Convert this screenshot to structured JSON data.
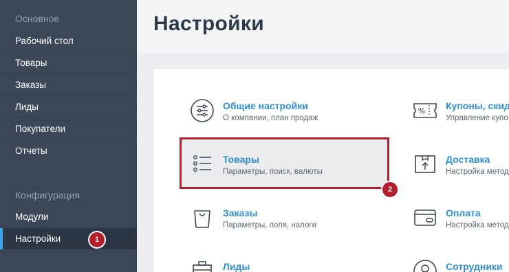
{
  "sidebar": {
    "section_main": "Основное",
    "main_items": [
      {
        "label": "Рабочий стол"
      },
      {
        "label": "Товары"
      },
      {
        "label": "Заказы"
      },
      {
        "label": "Лиды"
      },
      {
        "label": "Покупатели"
      },
      {
        "label": "Отчеты"
      }
    ],
    "section_config": "Конфигурация",
    "config_items": [
      {
        "label": "Модули"
      },
      {
        "label": "Настройки"
      }
    ],
    "badge_1": "1"
  },
  "header": {
    "title": "Настройки"
  },
  "tiles": [
    {
      "title": "Общие настройки",
      "subtitle": "О компании, план продаж",
      "icon": "sliders-icon"
    },
    {
      "title": "Товары",
      "subtitle": "Параметры, поиск, валюты",
      "icon": "list-icon"
    },
    {
      "title": "Заказы",
      "subtitle": "Параметры, поля, налоги",
      "icon": "shopping-bag-icon"
    },
    {
      "title": "Лиды",
      "subtitle": "",
      "icon": "briefcase-icon"
    },
    {
      "title": "Купоны, скид",
      "subtitle": "Управление купо",
      "icon": "coupon-icon"
    },
    {
      "title": "Доставка",
      "subtitle": "Настройка метод",
      "icon": "package-icon"
    },
    {
      "title": "Оплата",
      "subtitle": "Настройка метод",
      "icon": "wallet-icon"
    },
    {
      "title": "Сотрудники",
      "subtitle": "",
      "icon": "user-icon"
    }
  ],
  "badge_2": "2",
  "colors": {
    "sidebar": "#3b4656",
    "accent": "#3aa2e6",
    "link": "#2f8fd0",
    "highlight": "#b51f2b"
  }
}
